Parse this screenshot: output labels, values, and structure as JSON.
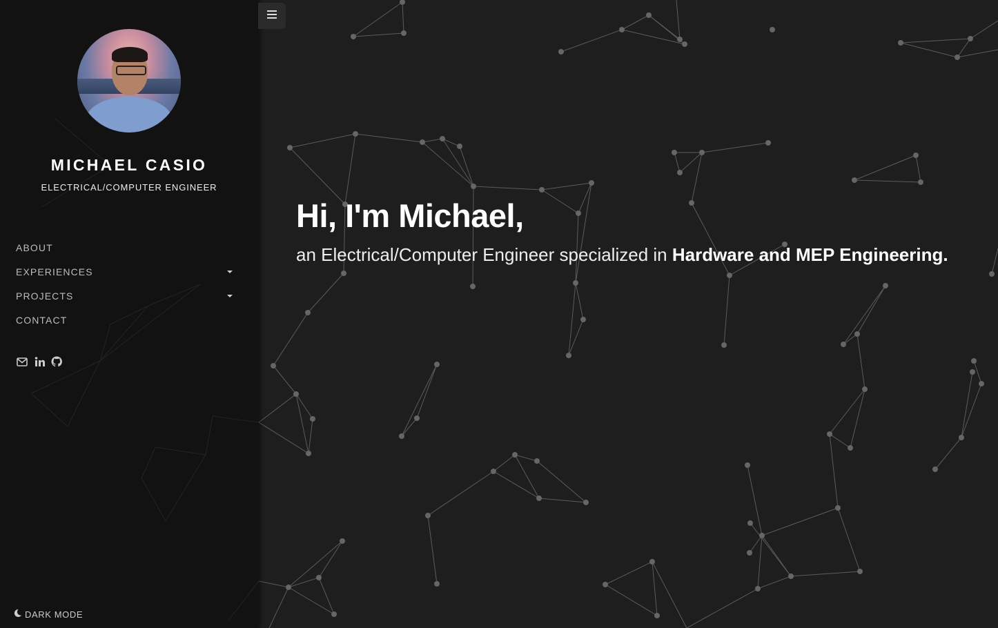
{
  "profile": {
    "name": "MICHAEL CASIO",
    "title": "ELECTRICAL/COMPUTER ENGINEER"
  },
  "nav": {
    "items": [
      {
        "label": "ABOUT",
        "has_dropdown": false
      },
      {
        "label": "EXPERIENCES",
        "has_dropdown": true
      },
      {
        "label": "PROJECTS",
        "has_dropdown": true
      },
      {
        "label": "CONTACT",
        "has_dropdown": false
      }
    ]
  },
  "social": {
    "icons": [
      "mail-icon",
      "linkedin-icon",
      "github-icon"
    ]
  },
  "theme_toggle": {
    "label": "DARK MODE",
    "icon": "moon-icon"
  },
  "hero": {
    "greeting": "Hi, I'm Michael,",
    "intro": "an Electrical/Computer Engineer specialized in ",
    "specialty": "Hardware and MEP Engineering."
  },
  "colors": {
    "background": "#1e1e1e",
    "sidebar": "#111111",
    "text": "#ffffff",
    "nav_text": "#bdbdbd",
    "network": "#6a6a6a"
  }
}
